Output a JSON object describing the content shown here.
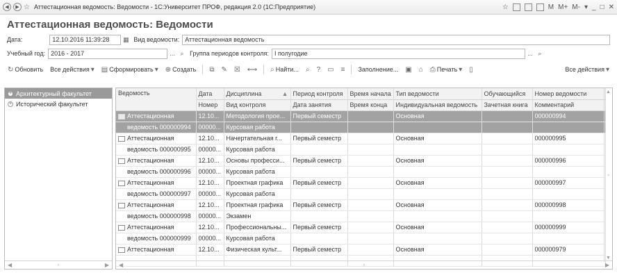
{
  "window": {
    "title": "Аттестационная ведомость: Ведомости - 1С:Университет ПРОФ, редакция 2.0  (1С:Предприятие)",
    "right_buttons": [
      "M",
      "M+",
      "M-"
    ]
  },
  "page_title": "Аттестационная ведомость: Ведомости",
  "filters": {
    "date_label": "Дата:",
    "date_value": "12.10.2016 11:39:28",
    "type_label": "Вид ведомости:",
    "type_value": "Аттестационная ведомость",
    "year_label": "Учебный год:",
    "year_value": "2016 - 2017",
    "ellipsis": "...",
    "period_group_label": "Группа периодов контроля:",
    "period_group_value": "I полугодие"
  },
  "toolbar": {
    "refresh": "Обновить",
    "all_actions": "Все действия",
    "generate": "Сформировать",
    "create": "Создать",
    "find": "Найти...",
    "fill": "Заполнение...",
    "print": "Печать",
    "all_actions_right": "Все действия"
  },
  "tree": [
    {
      "label": "Архитектурный факультет",
      "selected": true
    },
    {
      "label": "Исторический факультет",
      "selected": false
    }
  ],
  "table": {
    "headers_top": [
      "Ведомость",
      "Дата",
      "Дисциплина",
      "Период контроля",
      "Время начала",
      "Тип ведомости",
      "Обучающийся",
      "Номер ведомости"
    ],
    "headers_bottom": [
      "",
      "Номер",
      "Вид контроля",
      "Дата занятия",
      "Время конца",
      "Индивидуальная ведомость",
      "Зачетная книга",
      "Комментарий"
    ],
    "rows": [
      {
        "l1": "Аттестационная",
        "l2": "ведомость 000000994",
        "date": "12.10...",
        "num": "00000...",
        "disc": "Методология прое...",
        "kind": "Курсовая работа",
        "period": "Первый семестр",
        "type": "Основная",
        "docnum": "000000994",
        "selected": true
      },
      {
        "l1": "Аттестационная",
        "l2": "ведомость 000000995",
        "date": "12.10...",
        "num": "00000...",
        "disc": "Начертательная г...",
        "kind": "Курсовая работа",
        "period": "Первый семестр",
        "type": "Основная",
        "docnum": "000000995",
        "selected": false
      },
      {
        "l1": "Аттестационная",
        "l2": "ведомость 000000996",
        "date": "12.10...",
        "num": "00000...",
        "disc": "Основы професси...",
        "kind": "Курсовая работа",
        "period": "Первый семестр",
        "type": "Основная",
        "docnum": "000000996",
        "selected": false
      },
      {
        "l1": "Аттестационная",
        "l2": "ведомость 000000997",
        "date": "12.10...",
        "num": "00000...",
        "disc": "Проектная графика",
        "kind": "Курсовая работа",
        "period": "Первый семестр",
        "type": "Основная",
        "docnum": "000000997",
        "selected": false
      },
      {
        "l1": "Аттестационная",
        "l2": "ведомость 000000998",
        "date": "12.10...",
        "num": "00000...",
        "disc": "Проектная графика",
        "kind": "Экзамен",
        "period": "Первый семестр",
        "type": "Основная",
        "docnum": "000000998",
        "selected": false
      },
      {
        "l1": "Аттестационная",
        "l2": "ведомость 000000999",
        "date": "12.10...",
        "num": "00000...",
        "disc": "Профессиональны...",
        "kind": "Курсовая работа",
        "period": "Первый семестр",
        "type": "Основная",
        "docnum": "000000999",
        "selected": false
      },
      {
        "l1": "Аттестационная",
        "l2": "",
        "date": "12.10...",
        "num": "",
        "disc": "Физическая культ...",
        "kind": "",
        "period": "Первый семестр",
        "type": "Основная",
        "docnum": "000000979",
        "selected": false
      }
    ]
  }
}
